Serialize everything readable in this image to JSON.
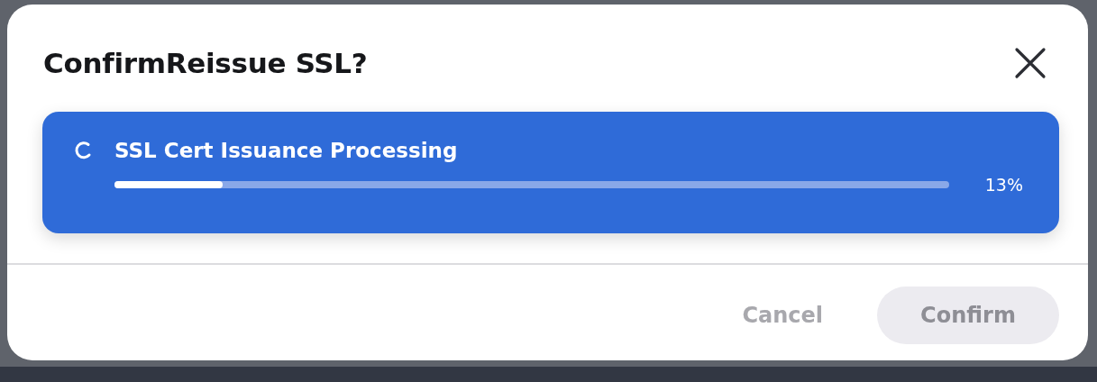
{
  "dialog": {
    "title": "ConfirmReissue SSL?"
  },
  "progress": {
    "label": "SSL Cert Issuance Processing",
    "level": 0.13,
    "reading": "13%",
    "busy": true
  },
  "buttons": [
    {
      "label": "Cancel",
      "kind": "text",
      "disabled": true
    },
    {
      "label": "Confirm",
      "kind": "filled",
      "disabled": true
    }
  ]
}
